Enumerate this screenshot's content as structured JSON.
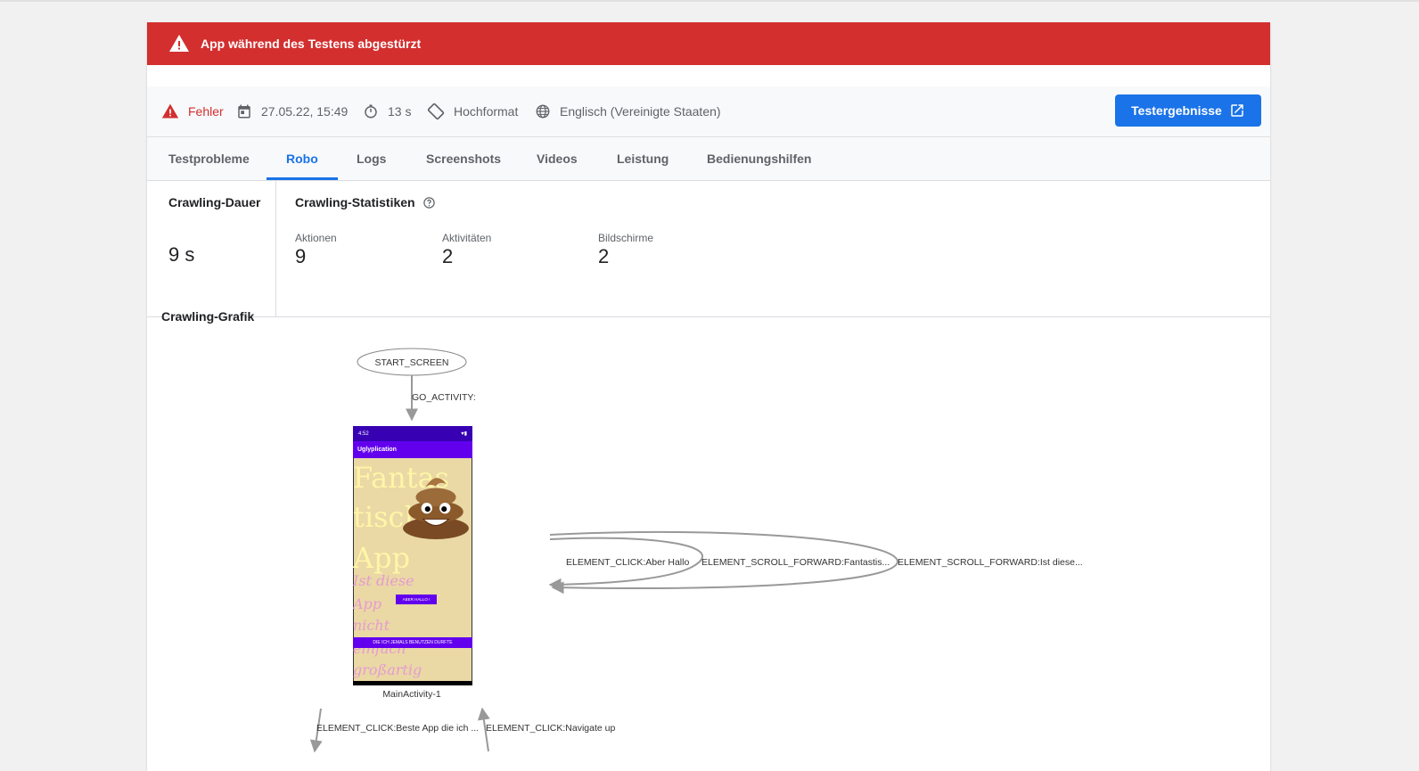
{
  "banner": {
    "text": "App während des Testens abgestürzt",
    "color": "#d32f2f"
  },
  "info": {
    "status": "Fehler",
    "date": "27.05.22, 15:49",
    "duration": "13 s",
    "orientation": "Hochformat",
    "locale": "Englisch (Vereinigte Staaten)",
    "results_button": "Testergebnisse"
  },
  "tabs": [
    "Testprobleme",
    "Robo",
    "Logs",
    "Screenshots",
    "Videos",
    "Leistung",
    "Bedienungshilfen"
  ],
  "active_tab": "Robo",
  "crawl": {
    "duration_title": "Crawling-Dauer",
    "duration_value": "9 s",
    "stats_title": "Crawling-Statistiken",
    "actions_label": "Aktionen",
    "actions_value": "9",
    "activities_label": "Aktivitäten",
    "activities_value": "2",
    "screens_label": "Bildschirme",
    "screens_value": "2"
  },
  "graph": {
    "title": "Crawling-Grafik",
    "start_node": "START_SCREEN",
    "edge_go": "GO_ACTIVITY:",
    "node_label": "MainActivity-1",
    "loop1": "ELEMENT_CLICK:Aber Hallo",
    "loop2": "ELEMENT_SCROLL_FORWARD:Fantastis...",
    "loop3": "ELEMENT_SCROLL_FORWARD:Ist diese...",
    "edge_out": "ELEMENT_CLICK:Beste App die ich ...",
    "edge_in": "ELEMENT_CLICK:Navigate up"
  },
  "phone": {
    "app_title": "Uglyplication",
    "big_lines": [
      "Fantas",
      "tisch",
      "App"
    ],
    "small_lines": [
      "Ist diese",
      "App",
      "nicht",
      "einfach",
      "großartig"
    ],
    "button": "ABER HALLO !",
    "wide_button": "DIE ICH JEMALS BENUTZEN DURFTE",
    "statusbar_left": "4:52"
  }
}
